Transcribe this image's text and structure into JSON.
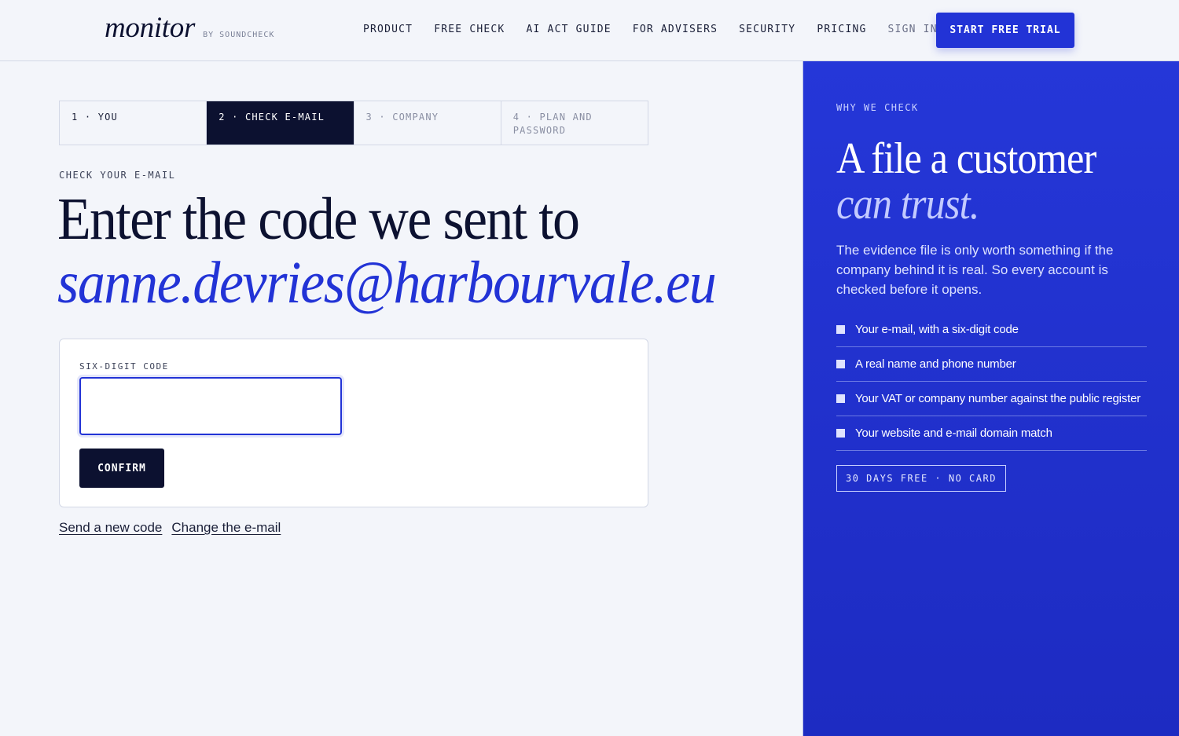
{
  "header": {
    "logo": "monitor",
    "logo_by": "BY SOUNDCHECK",
    "nav": [
      "PRODUCT",
      "FREE CHECK",
      "AI ACT GUIDE",
      "FOR ADVISERS",
      "SECURITY",
      "PRICING"
    ],
    "sign_in": "SIGN IN",
    "cta": "START FREE TRIAL"
  },
  "steps": [
    {
      "label": "1 · YOU",
      "state": "done"
    },
    {
      "label": "2 · CHECK E-MAIL",
      "state": "active"
    },
    {
      "label": "3 · COMPANY",
      "state": "future"
    },
    {
      "label": "4 · PLAN AND PASSWORD",
      "state": "future"
    }
  ],
  "main": {
    "eyebrow": "CHECK YOUR E-MAIL",
    "headline": "Enter the code we sent to",
    "email": "sanne.devries@harbourvale.eu",
    "code_label": "SIX-DIGIT CODE",
    "code_value": "",
    "confirm": "CONFIRM",
    "link_resend": "Send a new code",
    "link_change": "Change the e-mail"
  },
  "panel": {
    "eyebrow": "WHY WE CHECK",
    "title": "A file a customer",
    "title_em": "can trust.",
    "body": "The evidence file is only worth something if the company behind it is real. So every account is checked before it opens.",
    "checks": [
      "Your e-mail, with a six-digit code",
      "A real name and phone number",
      "Your VAT or company number against the public register",
      "Your website and e-mail domain match"
    ],
    "badge": "30 DAYS FREE · NO CARD"
  },
  "colors": {
    "accent": "#2233d6",
    "ink": "#0c1130",
    "background": "#f3f5fa"
  }
}
